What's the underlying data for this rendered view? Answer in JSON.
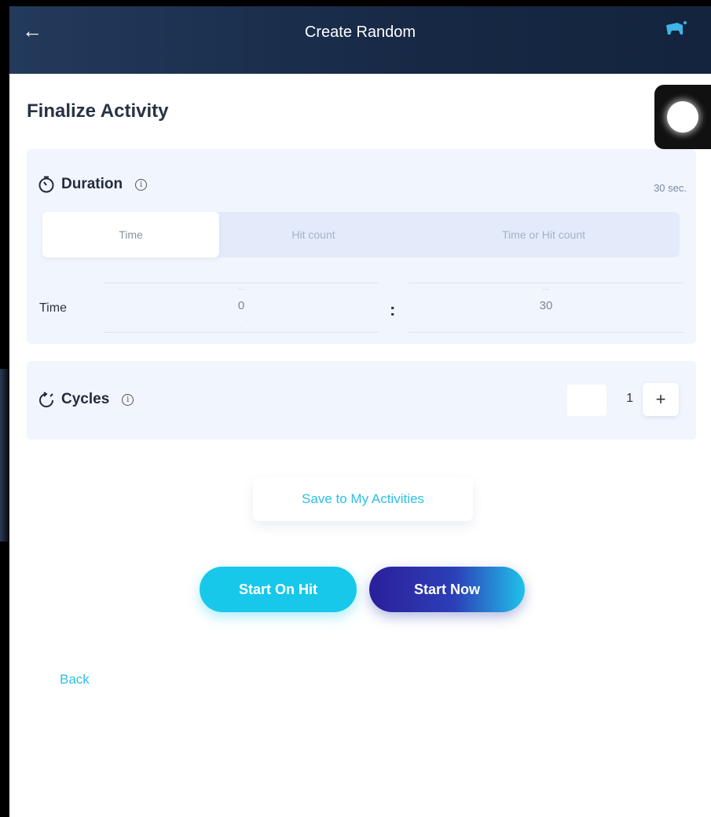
{
  "header": {
    "title": "Create Random"
  },
  "page": {
    "title": "Finalize Activity"
  },
  "duration": {
    "label": "Duration",
    "value": "30 sec.",
    "tabs": [
      "Time",
      "Hit count",
      "Time or Hit count"
    ],
    "selected_tab": "Time",
    "time_label": "Time",
    "minutes": "0",
    "seconds": "30",
    "separator": ":"
  },
  "cycles": {
    "label": "Cycles",
    "value": "1",
    "plus": "+"
  },
  "buttons": {
    "save": "Save to My Activities",
    "start_on_hit": "Start On Hit",
    "start_now": "Start Now",
    "back": "Back"
  },
  "colors": {
    "header_bg": "#1b2f4e",
    "accent_cyan": "#17c8ea",
    "accent_indigo": "#2b1f9a",
    "card_bg": "#f1f5fd"
  },
  "icons": {
    "back": "arrow-left-icon",
    "device": "device-icon",
    "timer": "timer-icon",
    "cycles": "cycle-icon",
    "info": "info-icon",
    "record": "record-icon"
  }
}
